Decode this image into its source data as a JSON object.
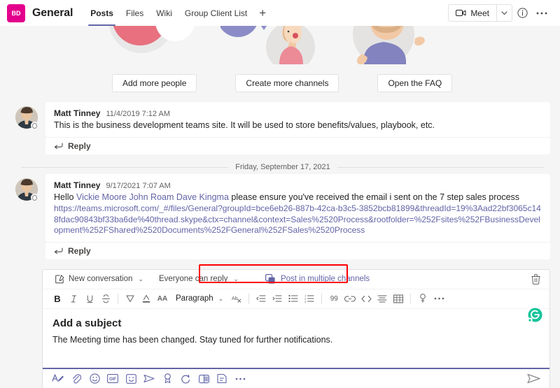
{
  "header": {
    "team_initials": "BD",
    "team_avatar_color": "#e3008c",
    "channel_title": "General",
    "tabs": [
      {
        "label": "Posts",
        "active": true
      },
      {
        "label": "Files",
        "active": false
      },
      {
        "label": "Wiki",
        "active": false
      },
      {
        "label": "Group Client List",
        "active": false
      }
    ],
    "add_tab_label": "+",
    "meet_label": "Meet",
    "meet_caret": "⌄",
    "info_icon": "info-icon",
    "more_icon": "…"
  },
  "banner": {
    "buttons": [
      {
        "label": "Add more people"
      },
      {
        "label": "Create more channels"
      },
      {
        "label": "Open the FAQ"
      }
    ]
  },
  "conversation": {
    "messages": [
      {
        "author": "Matt Tinney",
        "timestamp": "11/4/2019 7:12 AM",
        "text": "This is the business development teams site. It will be used to store benefits/values, playbook, etc.",
        "reply_label": "Reply"
      },
      {
        "author": "Matt Tinney",
        "timestamp": "9/17/2021 7:07 AM",
        "greeting": "Hello ",
        "mentions": "Vickie Moore John Roam Dave Kingma",
        "text_after": " please ensure you've received the email i sent on the 7 step sales process",
        "link": "https://teams.microsoft.com/_#/files/General?groupId=bce6eb26-887b-42ca-b3c5-3852bcb81899&threadId=19%3Aad22bf3065c148fdac90843bf33ba6de%40thread.skype&ctx=channel&context=Sales%2520Process&rootfolder=%252Fsites%252FBusinessDevelopment%252FShared%2520Documents%252FGeneral%252FSales%2520Process",
        "reply_label": "Reply"
      }
    ],
    "date_divider": "Friday, September 17, 2021"
  },
  "compose": {
    "new_conversation_label": "New conversation",
    "reply_setting_label": "Everyone can reply",
    "caret": "⌄",
    "post_multiple_label": "Post in multiple channels",
    "highlight_color": "#ff0000",
    "delete_icon": "trash-icon",
    "format_toolbar": [
      {
        "name": "bold",
        "glyph": "B"
      },
      {
        "name": "italic",
        "glyph": "I"
      },
      {
        "name": "underline",
        "glyph": "U"
      },
      {
        "name": "strikethrough",
        "glyph": "S"
      },
      {
        "name": "highlight",
        "glyph": "▽"
      },
      {
        "name": "font-color",
        "glyph": "A"
      },
      {
        "name": "font-size",
        "glyph": "AA"
      }
    ],
    "paragraph_label": "Paragraph",
    "format_toolbar_2": [
      {
        "name": "clear-formatting",
        "glyph": "Ab"
      },
      {
        "name": "decrease-indent",
        "glyph": "⇤"
      },
      {
        "name": "increase-indent",
        "glyph": "⇥"
      },
      {
        "name": "bulleted-list",
        "glyph": "☰"
      },
      {
        "name": "numbered-list",
        "glyph": "1."
      },
      {
        "name": "quote",
        "glyph": "99"
      },
      {
        "name": "insert-link",
        "glyph": "⚭"
      },
      {
        "name": "code-block",
        "glyph": "</>"
      },
      {
        "name": "align",
        "glyph": "≡"
      },
      {
        "name": "insert-table",
        "glyph": "⊞"
      },
      {
        "name": "insert-element",
        "glyph": "♀"
      },
      {
        "name": "more-options",
        "glyph": "…"
      }
    ],
    "subject_placeholder": "Add a subject",
    "message_text": "The Meeting time has been changed. Stay tuned for further notifications.",
    "grammarly_letter": "G",
    "grammarly_color": "#15c39a",
    "bottom_toolbar": [
      {
        "name": "format",
        "glyph": "A"
      },
      {
        "name": "attach-file",
        "glyph": "📎"
      },
      {
        "name": "emoji",
        "glyph": "☺"
      },
      {
        "name": "giphy",
        "glyph": "GIF"
      },
      {
        "name": "sticker",
        "glyph": "□"
      },
      {
        "name": "schedule-send",
        "glyph": "➤"
      },
      {
        "name": "praise",
        "glyph": "♁"
      },
      {
        "name": "loop",
        "glyph": "↻"
      },
      {
        "name": "meet-now",
        "glyph": "◰"
      },
      {
        "name": "approvals",
        "glyph": "⎘"
      },
      {
        "name": "more-apps",
        "glyph": "…"
      }
    ],
    "send_label": "send-icon"
  }
}
